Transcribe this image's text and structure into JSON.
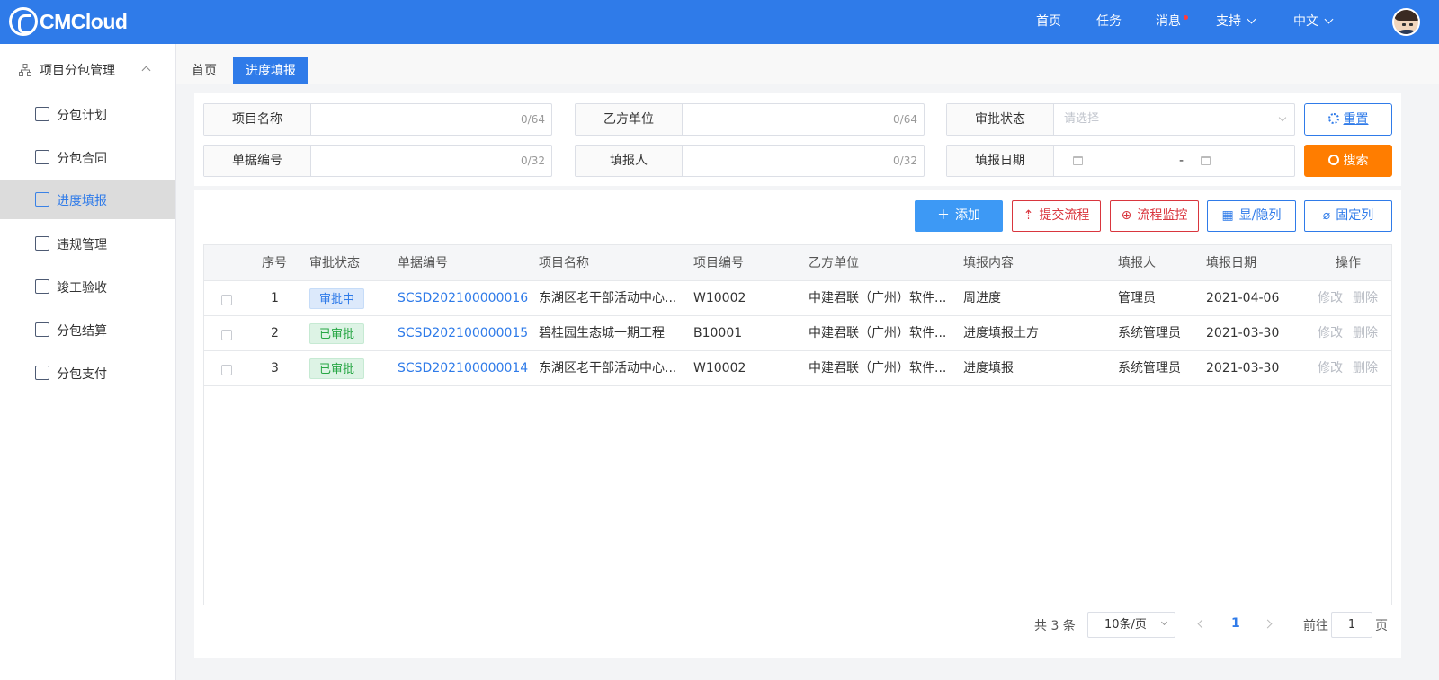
{
  "header": {
    "logo_text": "CMCloud",
    "nav": [
      "首页",
      "任务",
      "消息",
      "支持",
      "中文"
    ]
  },
  "sidebar": {
    "group_label": "项目分包管理",
    "items": [
      "分包计划",
      "分包合同",
      "进度填报",
      "违规管理",
      "竣工验收",
      "分包结算",
      "分包支付"
    ]
  },
  "tabs": [
    "首页",
    "进度填报"
  ],
  "filters": {
    "project_name": {
      "label": "项目名称",
      "count": "0/64"
    },
    "party_b": {
      "label": "乙方单位",
      "count": "0/64"
    },
    "approval_status": {
      "label": "审批状态",
      "placeholder": "请选择"
    },
    "doc_no": {
      "label": "单据编号",
      "count": "0/32"
    },
    "reporter": {
      "label": "填报人",
      "count": "0/32"
    },
    "report_date": {
      "label": "填报日期",
      "separator": "-"
    }
  },
  "buttons": {
    "reset": "重置",
    "search": "搜索",
    "add": "添加",
    "submit_flow": "提交流程",
    "flow_monitor": "流程监控",
    "toggle_cols": "显/隐列",
    "fix_cols": "固定列"
  },
  "table": {
    "headers": [
      "序号",
      "审批状态",
      "单据编号",
      "项目名称",
      "项目编号",
      "乙方单位",
      "填报内容",
      "填报人",
      "填报日期",
      "操作"
    ],
    "rows": [
      {
        "no": "1",
        "status": "审批中",
        "doc": "SCSD202100000016",
        "project": "东湖区老干部活动中心...",
        "code": "W10002",
        "party": "中建君联（广州）软件...",
        "content": "周进度",
        "reporter": "管理员",
        "date": "2021-04-06",
        "edit": "修改",
        "del": "删除"
      },
      {
        "no": "2",
        "status": "已审批",
        "doc": "SCSD202100000015",
        "project": "碧桂园生态城一期工程",
        "code": "B10001",
        "party": "中建君联（广州）软件...",
        "content": "进度填报土方",
        "reporter": "系统管理员",
        "date": "2021-03-30",
        "edit": "修改",
        "del": "删除"
      },
      {
        "no": "3",
        "status": "已审批",
        "doc": "SCSD202100000014",
        "project": "东湖区老干部活动中心...",
        "code": "W10002",
        "party": "中建君联（广州）软件...",
        "content": "进度填报",
        "reporter": "系统管理员",
        "date": "2021-03-30",
        "edit": "修改",
        "del": "删除"
      }
    ]
  },
  "pagination": {
    "total": "共 3 条",
    "page_size": "10条/页",
    "current": "1",
    "goto_label": "前往",
    "goto_value": "1",
    "page_suffix": "页"
  },
  "colors": {
    "primary": "#2f7be9",
    "orange": "#ff7d00",
    "danger": "#d9363e"
  }
}
